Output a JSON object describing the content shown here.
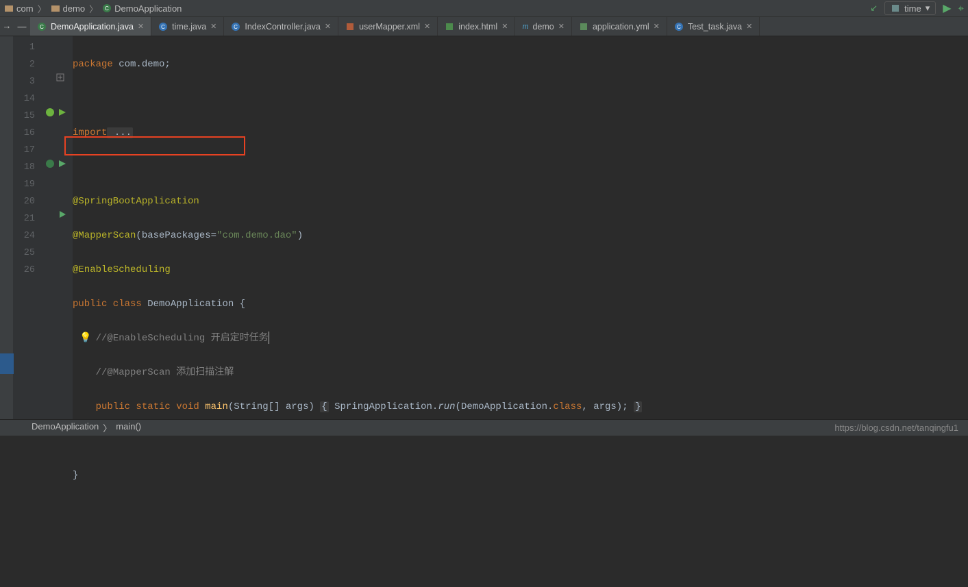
{
  "breadcrumbs": {
    "item1": "com",
    "item2": "demo",
    "item3": "DemoApplication"
  },
  "topbar": {
    "time_label": "time"
  },
  "tabs": [
    {
      "label": "DemoApplication.java",
      "active": true,
      "icon": "class"
    },
    {
      "label": "time.java",
      "active": false,
      "icon": "class"
    },
    {
      "label": "IndexController.java",
      "active": false,
      "icon": "class"
    },
    {
      "label": "userMapper.xml",
      "active": false,
      "icon": "xml"
    },
    {
      "label": "index.html",
      "active": false,
      "icon": "html"
    },
    {
      "label": "demo",
      "active": false,
      "icon": "maven"
    },
    {
      "label": "application.yml",
      "active": false,
      "icon": "yml"
    },
    {
      "label": "Test_task.java",
      "active": false,
      "icon": "class"
    }
  ],
  "line_numbers": [
    "1",
    "2",
    "3",
    "14",
    "15",
    "16",
    "17",
    "18",
    "19",
    "20",
    "21",
    "24",
    "25",
    "26"
  ],
  "code": {
    "pkg_kw": "package",
    "pkg_rest": " com.demo;",
    "imp_kw": "import",
    "imp_fold": " ...",
    "ann1": "@SpringBootApplication",
    "ann2a": "@MapperScan",
    "ann2b": "(",
    "ann2c": "basePackages",
    "ann2d": "=",
    "ann2e": "\"com.demo.dao\"",
    "ann2f": ")",
    "ann3": "@EnableScheduling",
    "cls_pub": "public class",
    "cls_name": " DemoApplication {",
    "cmt1": "//@EnableScheduling 开启定时任务",
    "cmt2": "//@MapperScan 添加扫描注解",
    "main_mods": "public static void",
    "main_name": " main",
    "main_sig": "(String[] args) ",
    "main_body_open": "{",
    "main_body_1": " SpringApplication.",
    "main_body_run": "run",
    "main_body_2": "(DemoApplication.",
    "main_body_cls": "class",
    "main_body_3": ", args); ",
    "main_body_close": "}",
    "close_brace": "}"
  },
  "status": {
    "left1": "DemoApplication",
    "sep": "〉",
    "left2": "main()",
    "watermark": "https://blog.csdn.net/tanqingfu1"
  }
}
